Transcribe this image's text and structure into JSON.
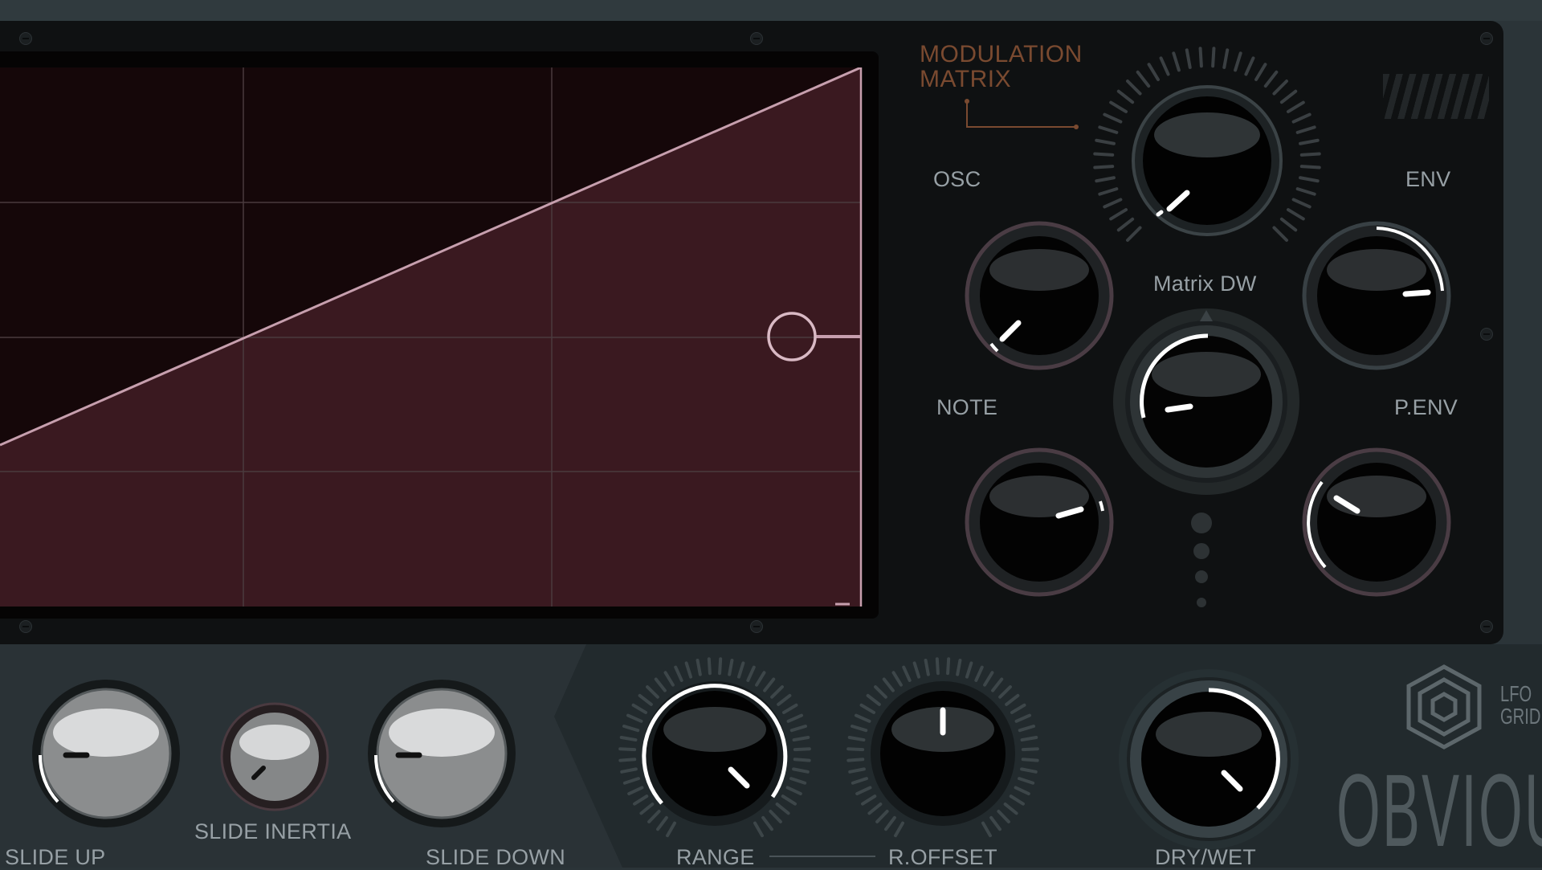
{
  "modulation_matrix": {
    "title_line1": "MODULATION",
    "title_line2": "MATRIX",
    "labels": {
      "osc": "OSC",
      "env": "ENV",
      "note": "NOTE",
      "penv": "P.ENV",
      "matrix_dw": "Matrix DW"
    }
  },
  "controls": {
    "slide_up": "SLIDE UP",
    "slide_inertia": "SLIDE INERTIA",
    "slide_down": "SLIDE DOWN",
    "range": "RANGE",
    "r_offset": "R.OFFSET",
    "dry_wet": "DRY/WET"
  },
  "branding": {
    "lfo_line1": "LFO",
    "lfo_line2": "GRID",
    "product": "OBVIOUS"
  },
  "colors": {
    "accent": "#c79fae",
    "fill": "#3c1a22",
    "title": "#7a4a30"
  }
}
